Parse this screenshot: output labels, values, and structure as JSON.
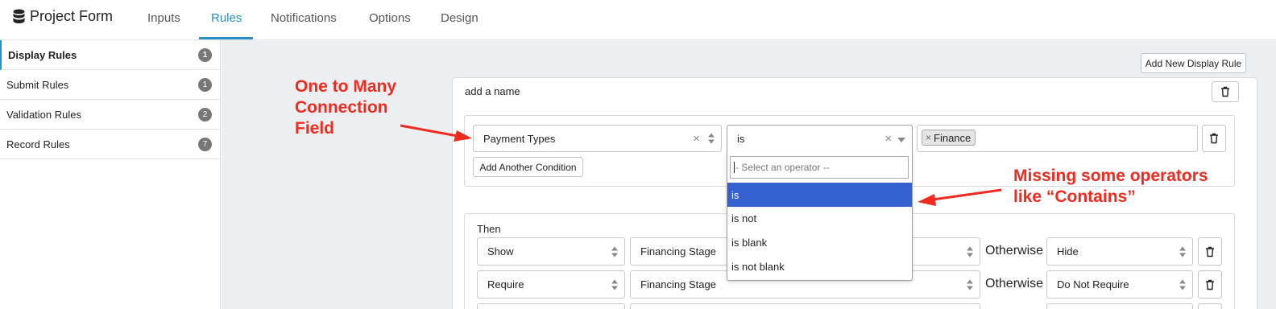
{
  "app": {
    "title": "Project Form"
  },
  "tabs": [
    {
      "label": "Inputs"
    },
    {
      "label": "Rules"
    },
    {
      "label": "Notifications"
    },
    {
      "label": "Options"
    },
    {
      "label": "Design"
    }
  ],
  "sidebar": {
    "items": [
      {
        "label": "Display Rules",
        "count": "1"
      },
      {
        "label": "Submit Rules",
        "count": "1"
      },
      {
        "label": "Validation Rules",
        "count": "2"
      },
      {
        "label": "Record Rules",
        "count": "7"
      }
    ]
  },
  "toolbar": {
    "add_rule_label": "Add New Display Rule"
  },
  "rule": {
    "name": "add a name",
    "condition": {
      "field": "Payment Types",
      "operator": "is",
      "value_tag": "Finance",
      "tag_remove": "×",
      "clear": "×",
      "add_condition_label": "Add Another Condition"
    },
    "then": {
      "label": "Then",
      "otherwise_label": "Otherwise",
      "actions": [
        {
          "action": "Show",
          "field": "Financing Stage",
          "otherwise": "Hide"
        },
        {
          "action": "Require",
          "field": "Financing Stage",
          "otherwise": "Do Not Require"
        }
      ]
    }
  },
  "operator_dropdown": {
    "placeholder": "- Select an operator --",
    "options": [
      {
        "label": "is",
        "highlighted": true
      },
      {
        "label": "is not"
      },
      {
        "label": "is blank"
      },
      {
        "label": "is not blank"
      }
    ]
  },
  "annotations": {
    "connection": [
      "One to Many",
      "Connection",
      "Field"
    ],
    "missing": [
      "Missing some operators",
      "like “Contains”"
    ]
  },
  "colors": {
    "accent": "#2a8fc8",
    "highlight": "#3461cf",
    "annotation": "#ef2b1f",
    "content_bg": "#eceff1"
  }
}
